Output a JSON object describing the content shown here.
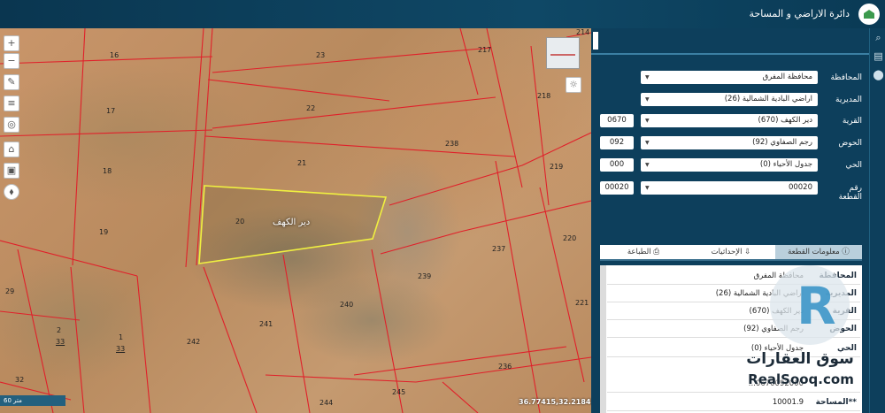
{
  "header": {
    "title": "دائرة الاراضي و المساحة"
  },
  "map": {
    "parcel_numbers": [
      {
        "id": "16",
        "text": "16"
      },
      {
        "id": "23",
        "text": "23"
      },
      {
        "id": "214",
        "text": "214"
      },
      {
        "id": "217",
        "text": "217"
      },
      {
        "id": "17",
        "text": "17"
      },
      {
        "id": "22",
        "text": "22"
      },
      {
        "id": "218",
        "text": "218"
      },
      {
        "id": "238",
        "text": "238"
      },
      {
        "id": "18",
        "text": "18"
      },
      {
        "id": "21",
        "text": "21"
      },
      {
        "id": "219",
        "text": "219"
      },
      {
        "id": "20",
        "text": "20"
      },
      {
        "id": "19",
        "text": "19"
      },
      {
        "id": "220",
        "text": "220"
      },
      {
        "id": "237",
        "text": "237"
      },
      {
        "id": "239",
        "text": "239"
      },
      {
        "id": "29",
        "text": "29"
      },
      {
        "id": "240",
        "text": "240"
      },
      {
        "id": "221",
        "text": "221"
      },
      {
        "id": "241",
        "text": "241"
      },
      {
        "id": "2",
        "text": "2"
      },
      {
        "id": "33a",
        "text": "33"
      },
      {
        "id": "1",
        "text": "1"
      },
      {
        "id": "33b",
        "text": "33"
      },
      {
        "id": "242",
        "text": "242"
      },
      {
        "id": "236",
        "text": "236"
      },
      {
        "id": "32",
        "text": "32"
      },
      {
        "id": "245",
        "text": "245"
      },
      {
        "id": "244",
        "text": "244"
      }
    ],
    "parcel_label": "دير الكهف",
    "scale_text": "60 متر",
    "coordinates": "36.77415,32.21842",
    "tools": [
      "plus-icon",
      "minus-icon",
      "pencil-icon",
      "ruler-icon",
      "target-icon",
      "home-icon",
      "image-icon",
      "compass-icon"
    ]
  },
  "form": {
    "rows": [
      {
        "label": "المحافظة",
        "value": "محافظة المفرق",
        "code": ""
      },
      {
        "label": "المديرية",
        "value": "اراضي البادية الشمالية (26)",
        "code": ""
      },
      {
        "label": "القرية",
        "value": "دير الكهف (670)",
        "code": "0670"
      },
      {
        "label": "الحوض",
        "value": "رجم الصفاوي (92)",
        "code": "092"
      },
      {
        "label": "الحي",
        "value": "جدول الأحياء (0)",
        "code": "000"
      },
      {
        "label": "رقم القطعة",
        "value": "00020",
        "code": "00020"
      }
    ]
  },
  "tabs": [
    {
      "label": "معلومات القطعة",
      "active": true
    },
    {
      "label": "الإحداثيات",
      "active": false
    },
    {
      "label": "الطباعة",
      "active": false
    }
  ],
  "info": {
    "rows": [
      {
        "key": "المحافظة",
        "value": "محافظة المفرق"
      },
      {
        "key": "المديرية",
        "value": "اراضي البادية الشمالية (26)"
      },
      {
        "key": "القرية",
        "value": "دير الكهف (670)"
      },
      {
        "key": "الحوض",
        "value": "رجم الصفاوي (92)"
      },
      {
        "key": "الحي",
        "value": "جدول الأحياء (0)"
      },
      {
        "key": "",
        "value": "0670092000..."
      },
      {
        "key": "**المساحة",
        "value": "10001.9"
      }
    ]
  },
  "watermark": {
    "arabic": "سوق العقارات",
    "english": "RealSooq.com"
  },
  "colors": {
    "header_bg": "#0f4866",
    "panel_bg": "#0d3f5c",
    "parcel_line": "#e0202a",
    "selected_parcel": "#f0f040"
  }
}
